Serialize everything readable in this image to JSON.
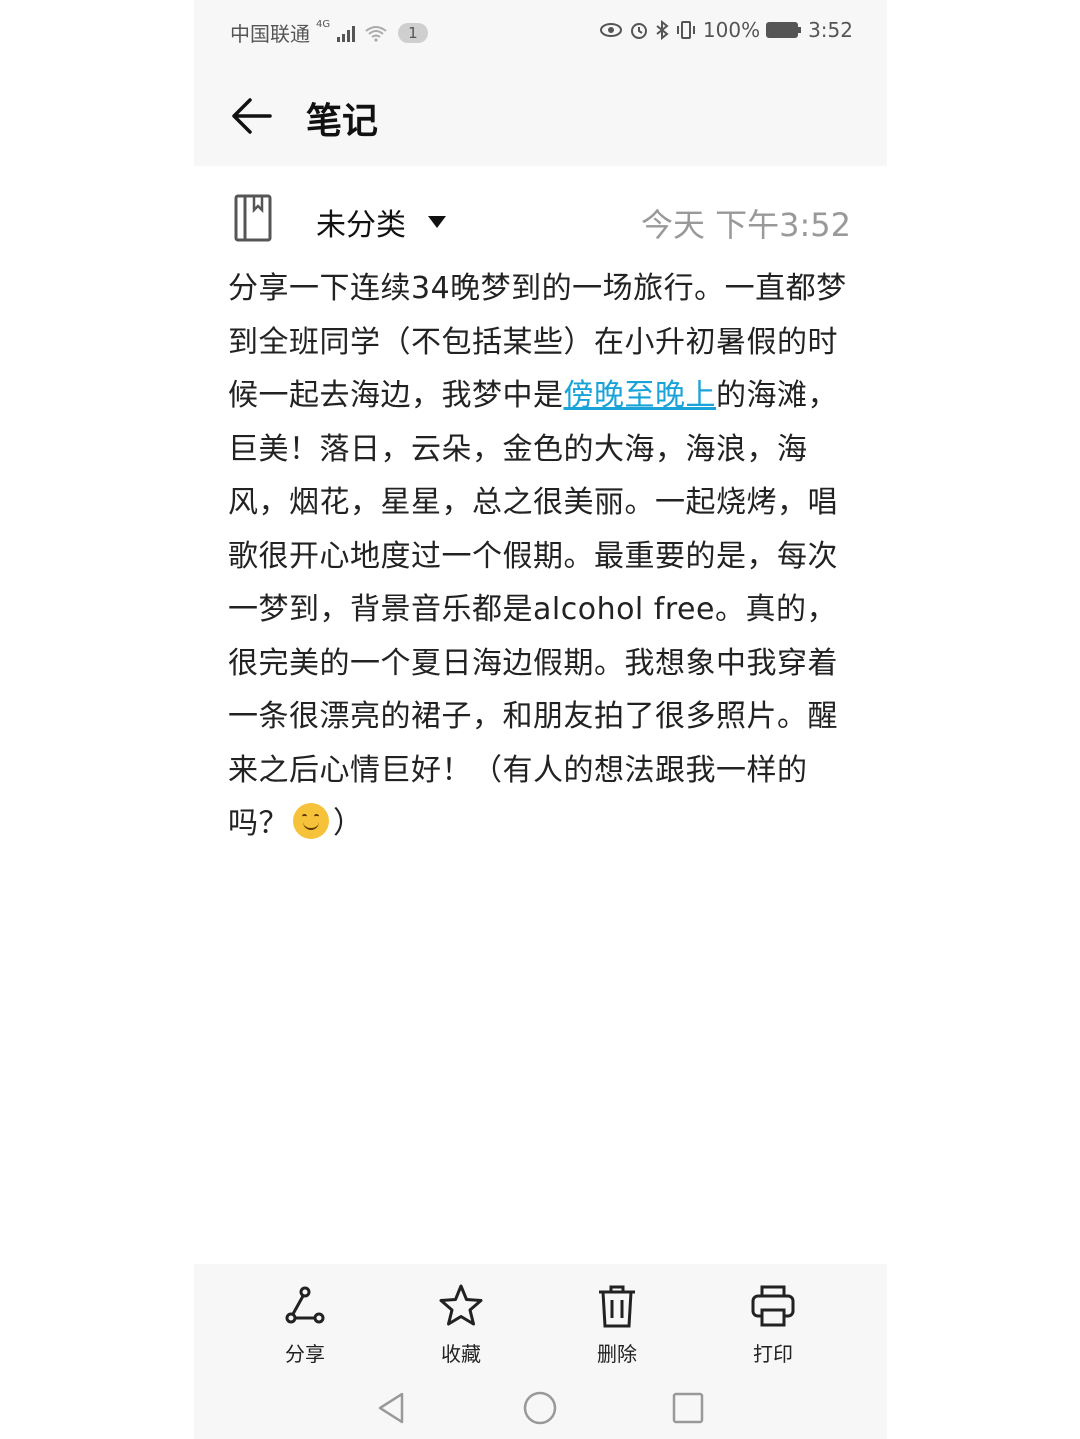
{
  "status_bar": {
    "carrier": "中国联通",
    "network": "4G",
    "badge": "1",
    "battery": "100%",
    "time": "3:52"
  },
  "app_bar": {
    "title": "笔记"
  },
  "note": {
    "category": "未分类",
    "timestamp": "今天 下午3:52",
    "text_before_link": "分享一下连续34晚梦到的一场旅行。一直都梦到全班同学（不包括某些）在小升初暑假的时候一起去海边，我梦中是",
    "link_text": "傍晚至晚上",
    "text_after_link": "的海滩，巨美！落日，云朵，金色的大海，海浪，海风，烟花，星星，总之很美丽。一起烧烤，唱歌很开心地度过一个假期。最重要的是，每次一梦到，背景音乐都是alcohol free。真的，很完美的一个夏日海边假期。我想象中我穿着一条很漂亮的裙子，和朋友拍了很多照片。醒来之后心情巨好！（有人的想法跟我一样的吗？",
    "text_end": "）"
  },
  "toolbar": {
    "share_label": "分享",
    "favorite_label": "收藏",
    "delete_label": "删除",
    "print_label": "打印"
  },
  "colors": {
    "link": "#1aa3d8",
    "bar_bg": "#f7f7f7",
    "timestamp": "#999999"
  }
}
